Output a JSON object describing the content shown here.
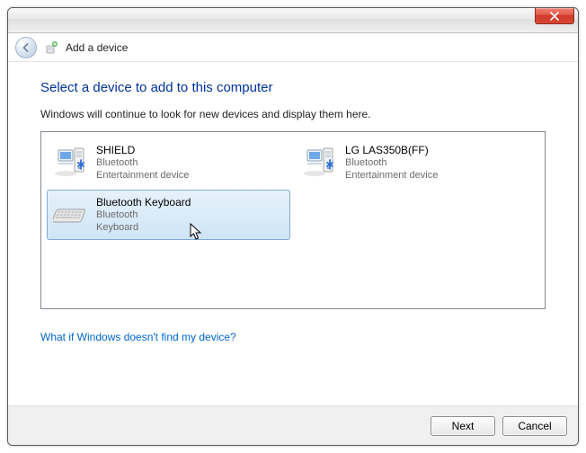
{
  "window": {
    "title": "Add a device"
  },
  "heading": "Select a device to add to this computer",
  "subtext": "Windows will continue to look for new devices and display them here.",
  "devices": [
    {
      "name": "SHIELD",
      "type": "Bluetooth",
      "category": "Entertainment device",
      "icon": "desktop",
      "selected": false
    },
    {
      "name": "LG LAS350B(FF)",
      "type": "Bluetooth",
      "category": "Entertainment device",
      "icon": "desktop",
      "selected": false
    },
    {
      "name": "Bluetooth  Keyboard",
      "type": "Bluetooth",
      "category": "Keyboard",
      "icon": "keyboard",
      "selected": true
    }
  ],
  "help_link": "What if Windows doesn't find my device?",
  "buttons": {
    "next": "Next",
    "cancel": "Cancel"
  }
}
